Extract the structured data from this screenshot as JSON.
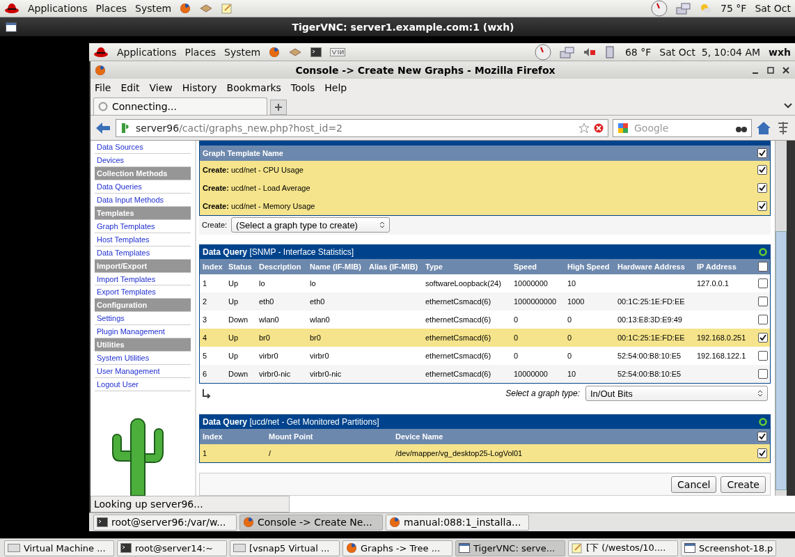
{
  "outer_panel": {
    "menus": [
      "Applications",
      "Places",
      "System"
    ],
    "weather": "75 °F",
    "clock": "Sat Oct"
  },
  "vnc_window": {
    "title": "TigerVNC: server1.example.com:1 (wxh)"
  },
  "inner_panel": {
    "menus": [
      "Applications",
      "Places",
      "System"
    ],
    "weather": "68 °F",
    "clock": "Sat Oct  5, 10:04 AM",
    "user": "wxh"
  },
  "browser": {
    "title": "Console -> Create New Graphs - Mozilla Firefox",
    "menu": [
      "File",
      "Edit",
      "View",
      "History",
      "Bookmarks",
      "Tools",
      "Help"
    ],
    "tab": {
      "label": "Connecting..."
    },
    "url": {
      "host": "server96",
      "path": "/cacti/graphs_new.php?host_id=2"
    },
    "search": {
      "placeholder": "Google"
    },
    "status": "Looking up server96..."
  },
  "sidebar": [
    {
      "kind": "link",
      "label": "Data Sources"
    },
    {
      "kind": "link",
      "label": "Devices"
    },
    {
      "kind": "header",
      "label": "Collection Methods"
    },
    {
      "kind": "link",
      "label": "Data Queries"
    },
    {
      "kind": "link",
      "label": "Data Input Methods"
    },
    {
      "kind": "header",
      "label": "Templates"
    },
    {
      "kind": "link",
      "label": "Graph Templates"
    },
    {
      "kind": "link",
      "label": "Host Templates"
    },
    {
      "kind": "link",
      "label": "Data Templates"
    },
    {
      "kind": "header",
      "label": "Import/Export"
    },
    {
      "kind": "link",
      "label": "Import Templates"
    },
    {
      "kind": "link",
      "label": "Export Templates"
    },
    {
      "kind": "header",
      "label": "Configuration"
    },
    {
      "kind": "link",
      "label": "Settings"
    },
    {
      "kind": "link",
      "label": "Plugin Management"
    },
    {
      "kind": "header",
      "label": "Utilities"
    },
    {
      "kind": "link",
      "label": "System Utilities"
    },
    {
      "kind": "link",
      "label": "User Management"
    },
    {
      "kind": "link",
      "label": "Logout User"
    }
  ],
  "graph_templates": {
    "header": "Graph Template Name",
    "checked": true,
    "rows": [
      {
        "label": "**Create:** ucd/net - CPU Usage",
        "checked": true
      },
      {
        "label": "**Create:** ucd/net - Load Average",
        "checked": true
      },
      {
        "label": "**Create:** ucd/net - Memory Usage",
        "checked": true
      }
    ],
    "create_label": "Create:",
    "create_select": "(Select a graph type to create)"
  },
  "queries": [
    {
      "title": "Data Query",
      "subtitle": "[SNMP - Interface Statistics]",
      "checked": false,
      "columns": [
        "Index",
        "Status",
        "Description",
        "Name (IF-MIB)",
        "Alias (IF-MIB)",
        "Type",
        "Speed",
        "High Speed",
        "Hardware Address",
        "IP Address"
      ],
      "rows": [
        {
          "cells": [
            "1",
            "Up",
            "lo",
            "lo",
            "",
            "softwareLoopback(24)",
            "10000000",
            "10",
            "",
            "127.0.0.1"
          ],
          "selected": false,
          "checked": false
        },
        {
          "cells": [
            "2",
            "Up",
            "eth0",
            "eth0",
            "",
            "ethernetCsmacd(6)",
            "1000000000",
            "1000",
            "00:1C:25:1E:FD:EE",
            ""
          ],
          "selected": false,
          "checked": false
        },
        {
          "cells": [
            "3",
            "Down",
            "wlan0",
            "wlan0",
            "",
            "ethernetCsmacd(6)",
            "0",
            "0",
            "00:13:E8:3D:E9:49",
            ""
          ],
          "selected": false,
          "checked": false
        },
        {
          "cells": [
            "4",
            "Up",
            "br0",
            "br0",
            "",
            "ethernetCsmacd(6)",
            "0",
            "0",
            "00:1C:25:1E:FD:EE",
            "192.168.0.251"
          ],
          "selected": true,
          "checked": true
        },
        {
          "cells": [
            "5",
            "Up",
            "virbr0",
            "virbr0",
            "",
            "ethernetCsmacd(6)",
            "0",
            "0",
            "52:54:00:B8:10:E5",
            "192.168.122.1"
          ],
          "selected": false,
          "checked": false
        },
        {
          "cells": [
            "6",
            "Down",
            "virbr0-nic",
            "virbr0-nic",
            "",
            "ethernetCsmacd(6)",
            "10000000",
            "10",
            "52:54:00:B8:10:E5",
            ""
          ],
          "selected": false,
          "checked": false
        }
      ],
      "graph_type_label": "Select a graph type:",
      "graph_type": "In/Out Bits"
    },
    {
      "title": "Data Query",
      "subtitle": "[ucd/net - Get Monitored Partitions]",
      "checked": true,
      "columns": [
        "Index",
        "Mount Point",
        "Device Name"
      ],
      "rows": [
        {
          "cells": [
            "1",
            "/",
            "/dev/mapper/vg_desktop25-LogVol01"
          ],
          "selected": true,
          "checked": true
        }
      ]
    }
  ],
  "buttons": [
    "Cancel",
    "Create"
  ],
  "inner_taskbar": [
    {
      "label": "root@server96:/var/w...",
      "kind": "terminal",
      "selected": false
    },
    {
      "label": "Console -> Create Ne...",
      "kind": "browser",
      "selected": true
    },
    {
      "label": "manual:088:1_installa...",
      "kind": "browser",
      "selected": false
    }
  ],
  "outer_taskbar": [
    {
      "label": "Virtual Machine ...",
      "kind": "vm",
      "selected": false
    },
    {
      "label": "root@server14:~",
      "kind": "terminal",
      "selected": false
    },
    {
      "label": "[vsnap5 Virtual ...",
      "kind": "vm",
      "selected": false
    },
    {
      "label": "Graphs -> Tree ...",
      "kind": "browser",
      "selected": false
    },
    {
      "label": "TigerVNC: serve...",
      "kind": "window",
      "selected": true
    },
    {
      "label": "[下 (/westos/10....",
      "kind": "editor",
      "selected": false
    },
    {
      "label": "Screenshot-18.p",
      "kind": "window",
      "selected": false
    }
  ]
}
